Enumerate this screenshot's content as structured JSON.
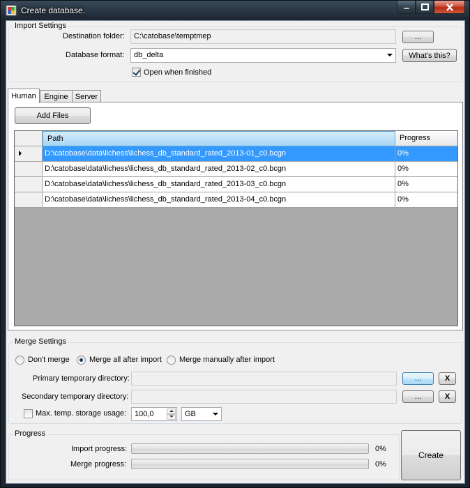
{
  "window": {
    "title": "Create database.",
    "icon": "database-app-icon",
    "controls": {
      "minimize": "minimize-icon",
      "maximize": "maximize-icon",
      "close": "close-icon"
    }
  },
  "import_settings": {
    "title": "Import Settings",
    "destination_label": "Destination folder:",
    "destination_value": "C:\\catobase\\temptmep",
    "browse_label": "...",
    "format_label": "Database format:",
    "format_value": "db_delta",
    "whats_this_label": "What's this?",
    "open_when_finished_label": "Open when finished",
    "open_when_finished_checked": true
  },
  "tabs": [
    {
      "label": "Human",
      "active": true
    },
    {
      "label": "Engine",
      "active": false
    },
    {
      "label": "Server",
      "active": false
    }
  ],
  "human": {
    "add_files_label": "Add Files",
    "columns": [
      "Path",
      "Progress"
    ],
    "rows": [
      {
        "path": "D:\\catobase\\data\\lichess\\lichess_db_standard_rated_2013-01_c0.bcgn",
        "progress": "0%",
        "selected": true
      },
      {
        "path": "D:\\catobase\\data\\lichess\\lichess_db_standard_rated_2013-02_c0.bcgn",
        "progress": "0%",
        "selected": false
      },
      {
        "path": "D:\\catobase\\data\\lichess\\lichess_db_standard_rated_2013-03_c0.bcgn",
        "progress": "0%",
        "selected": false
      },
      {
        "path": "D:\\catobase\\data\\lichess\\lichess_db_standard_rated_2013-04_c0.bcgn",
        "progress": "0%",
        "selected": false
      }
    ]
  },
  "merge_settings": {
    "title": "Merge Settings",
    "options": [
      {
        "label": "Don't merge",
        "selected": false
      },
      {
        "label": "Merge all after import",
        "selected": true
      },
      {
        "label": "Merge manually after import",
        "selected": false
      }
    ],
    "primary_label": "Primary temporary directory:",
    "primary_value": "",
    "secondary_label": "Secondary temporary directory:",
    "secondary_value": "",
    "browse_label": "...",
    "clear_label": "X",
    "max_storage_label": "Max. temp. storage usage:",
    "max_storage_checked": false,
    "max_storage_value": "100,0",
    "unit_value": "GB"
  },
  "progress": {
    "title": "Progress",
    "import_label": "Import progress:",
    "import_value": 0,
    "import_text": "0%",
    "merge_label": "Merge progress:",
    "merge_value": 0,
    "merge_text": "0%",
    "create_label": "Create"
  }
}
